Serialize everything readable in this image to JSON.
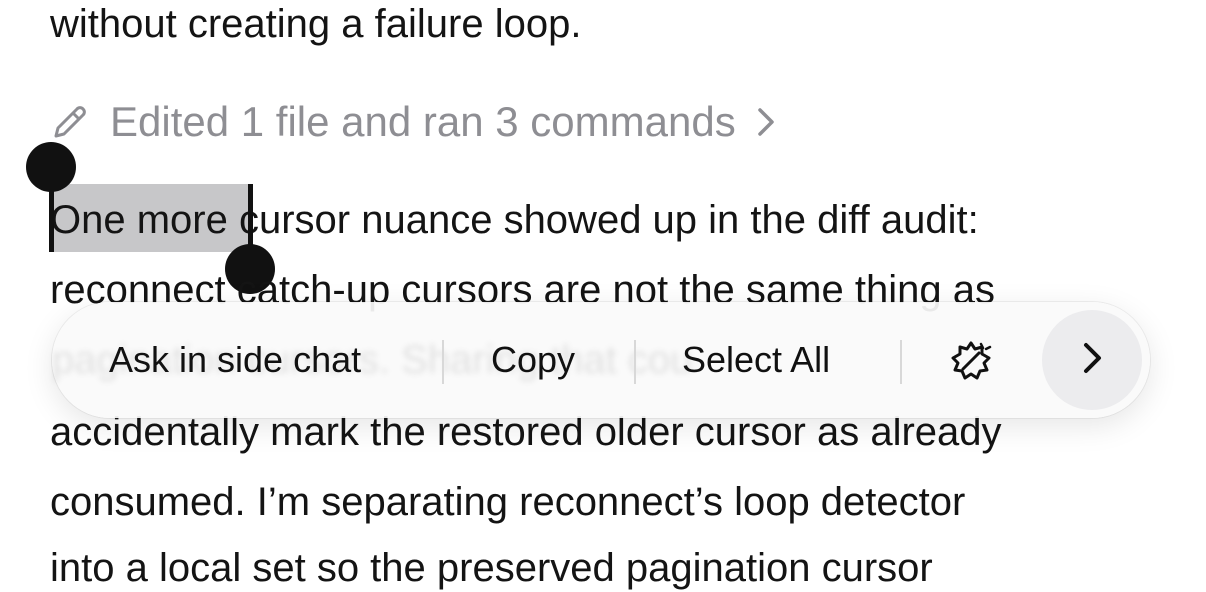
{
  "content": {
    "line1": "without creating a failure loop.",
    "activity": {
      "icon": "pencil-icon",
      "label": "Edited 1 file and ran 3 commands",
      "chevron": "chevron-right-icon"
    },
    "line3_selected": "One more",
    "line3_rest": " cursor nuance showed up in the diff audit:",
    "line4": "reconnect catch-up cursors are not the same thing as",
    "line5": "accidentally mark the restored older cursor as already",
    "line6": "consumed. I’m separating reconnect’s loop detector",
    "line7": "into a local set so the preserved pagination cursor"
  },
  "context_menu": {
    "items": [
      "Ask in side chat",
      "Copy",
      "Select All"
    ],
    "extra_icon": "sparkle-edit-icon",
    "more_icon": "chevron-right-icon",
    "obscured_text": "pagination cursors. Sharing that cou"
  },
  "colors": {
    "text": "#141414",
    "muted": "#8e8e93",
    "selection": "#c7c7c9",
    "handle": "#111111"
  }
}
